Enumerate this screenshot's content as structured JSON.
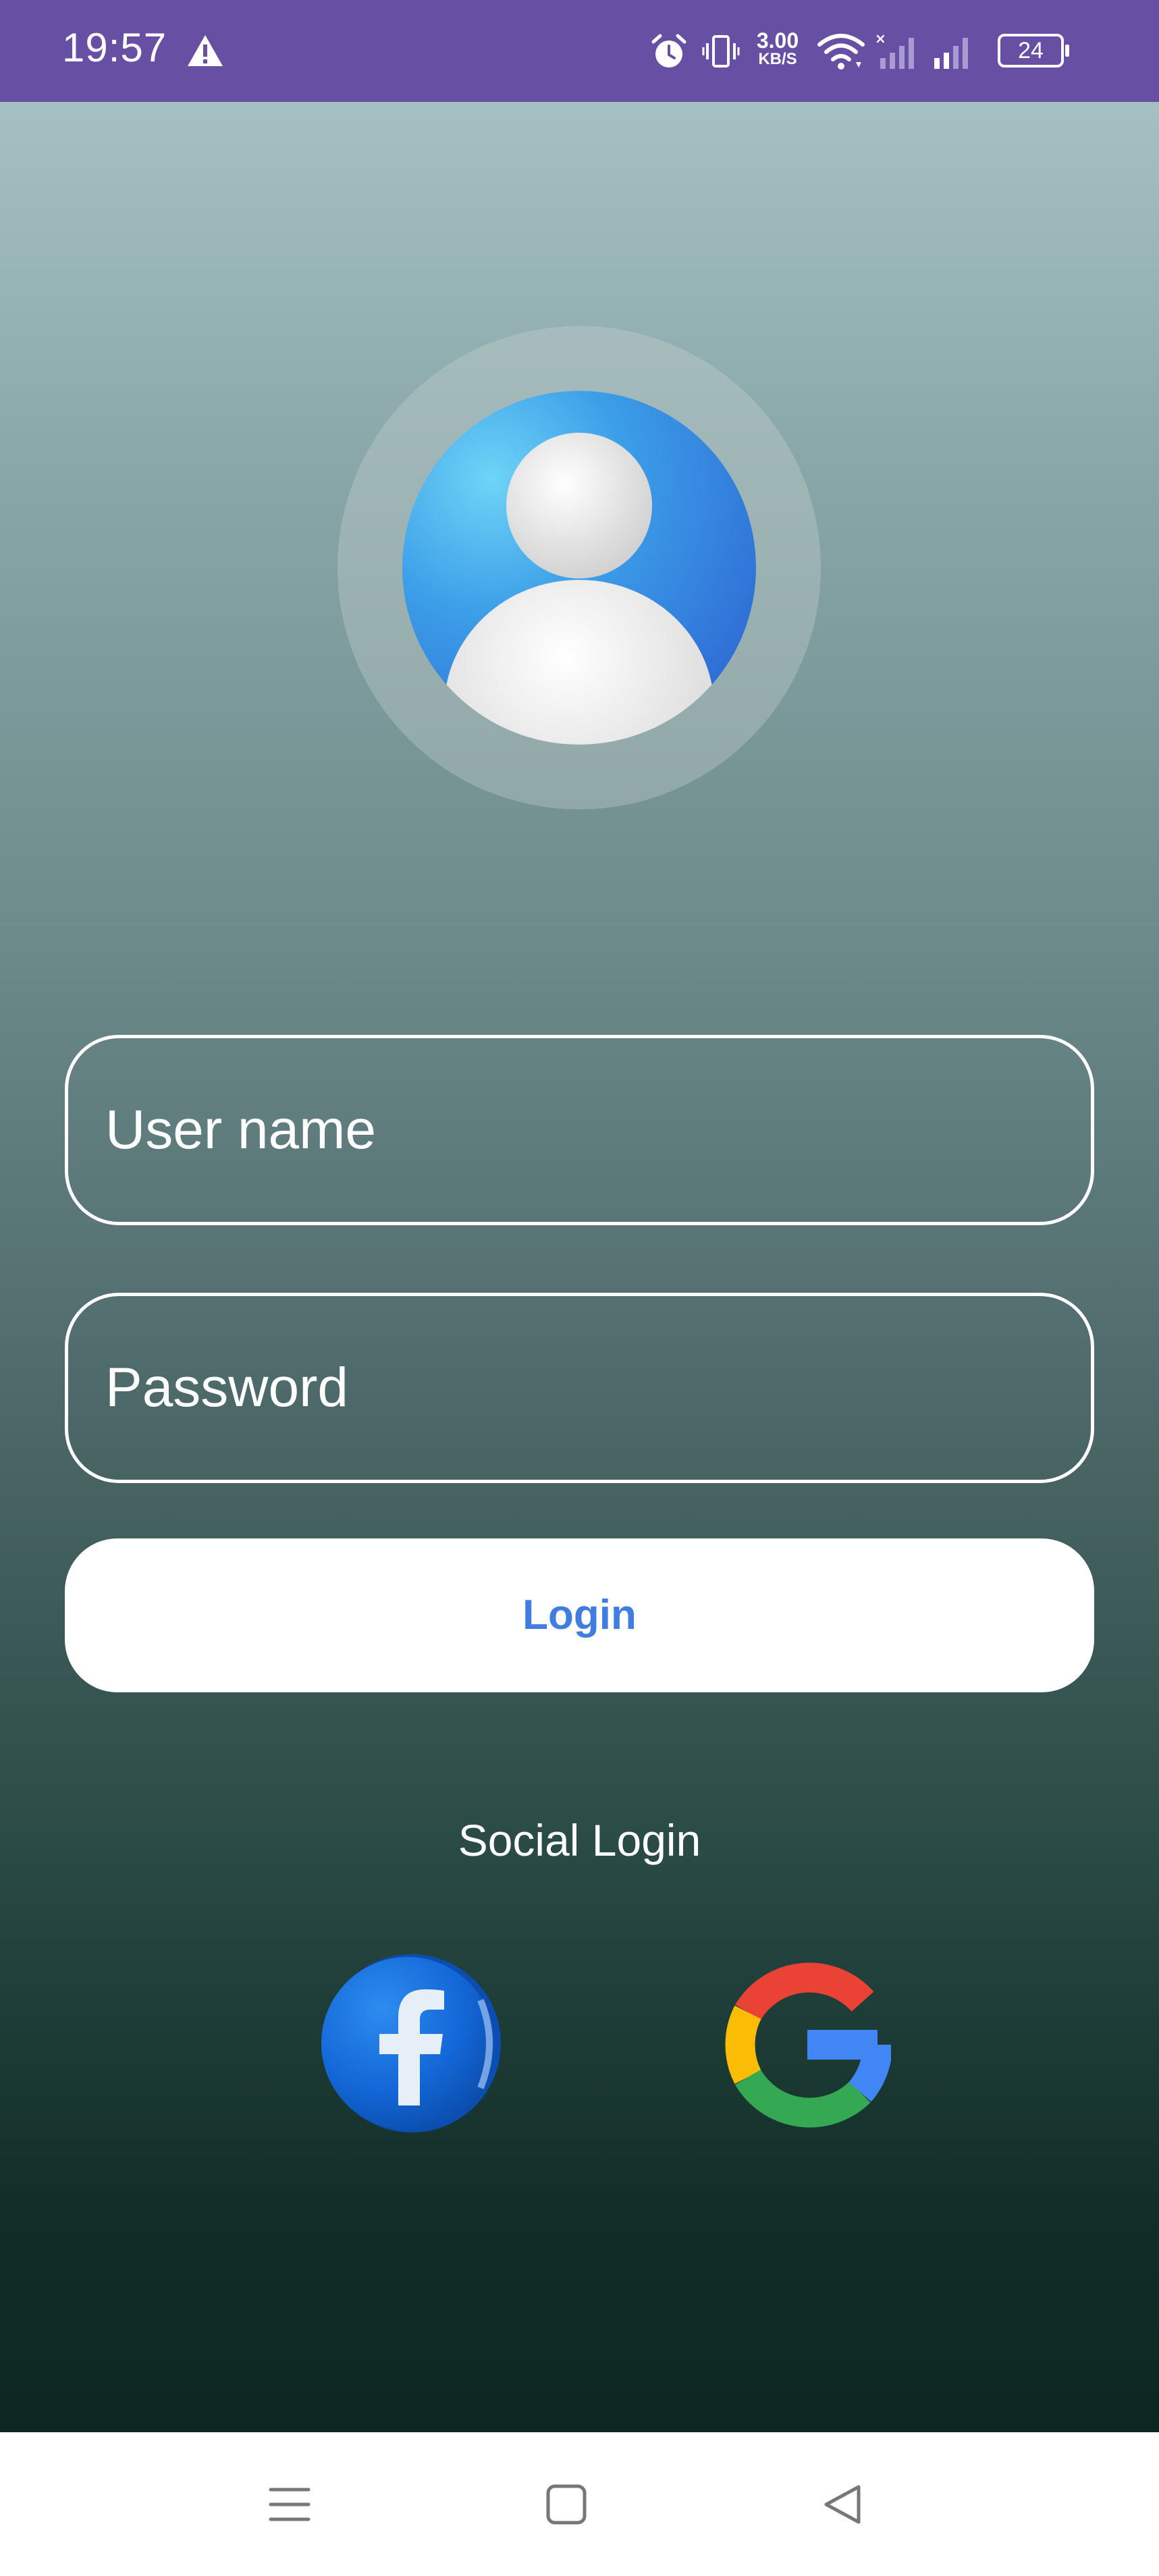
{
  "status_bar": {
    "time": "19:57",
    "net_speed_value": "3.00",
    "net_speed_unit": "KB/S",
    "battery": "24",
    "icons": [
      "alert-icon",
      "alarm-icon",
      "vibrate-icon",
      "wifi-icon",
      "signal-1-icon",
      "signal-2-icon"
    ],
    "background": "#6750a4"
  },
  "login_form": {
    "username_placeholder": "User name",
    "username_value": "",
    "password_placeholder": "Password",
    "password_value": "",
    "login_label": "Login",
    "login_text_color": "#3f7ee0"
  },
  "social": {
    "label": "Social Login",
    "providers": [
      "facebook-icon",
      "google-icon"
    ]
  },
  "nav_bar": {
    "items": [
      "menu-icon",
      "home-icon",
      "back-icon"
    ]
  }
}
